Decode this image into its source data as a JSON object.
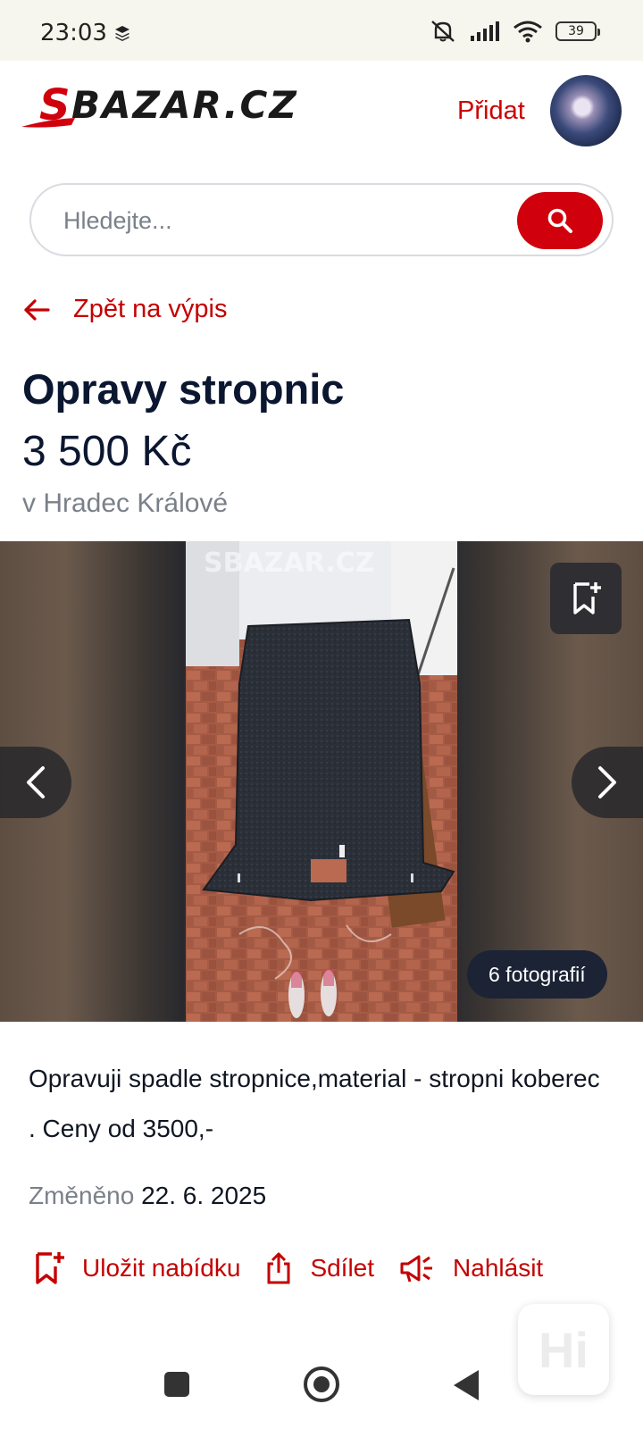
{
  "status_bar": {
    "time": "23:03",
    "battery": "39"
  },
  "header": {
    "logo_text": "SBAZAR.CZ",
    "add_label": "Přidat"
  },
  "search": {
    "placeholder": "Hledejte..."
  },
  "back_link": {
    "label": "Zpět na výpis"
  },
  "listing": {
    "title": "Opravy stropnic",
    "price": "3 500 Kč",
    "location": "v Hradec Králové",
    "photo_count": "6 fotografií",
    "watermark": "SBAZAR.CZ",
    "description": "Opravuji spadle stropnice,material - stropni koberec . Ceny od 3500,-",
    "changed_label": "Změněno",
    "changed_date": "22. 6. 2025"
  },
  "actions": {
    "save_label": "Uložit nabídku",
    "share_label": "Sdílet",
    "report_label": "Nahlásit"
  },
  "widget": {
    "label": "Hi"
  },
  "colors": {
    "brand_red": "#d0000c",
    "link_red": "#c40000",
    "title_navy": "#0b1730"
  }
}
